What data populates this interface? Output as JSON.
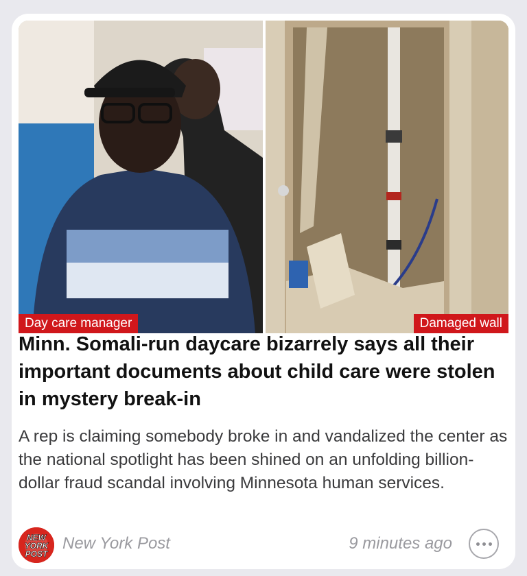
{
  "article": {
    "image_captions": {
      "left": "Day care manager",
      "right": "Damaged wall"
    },
    "headline": "Minn. Somali-run daycare bizarrely says all their important documents about child care were stolen in mystery break-in",
    "summary": "A rep is claiming somebody broke in and vandalized the center as the national spotlight has been shined on an unfolding billion-dollar fraud scandal involving Minnesota human services.",
    "source": "New York Post",
    "logo_text": [
      "NEW",
      "YORK",
      "POST"
    ],
    "timestamp": "9 minutes ago",
    "more_icon": "ellipsis-circle-icon"
  },
  "colors": {
    "caption_bg": "#d0171b",
    "brand": "#d7261e",
    "meta_text": "#9a9a9f"
  }
}
